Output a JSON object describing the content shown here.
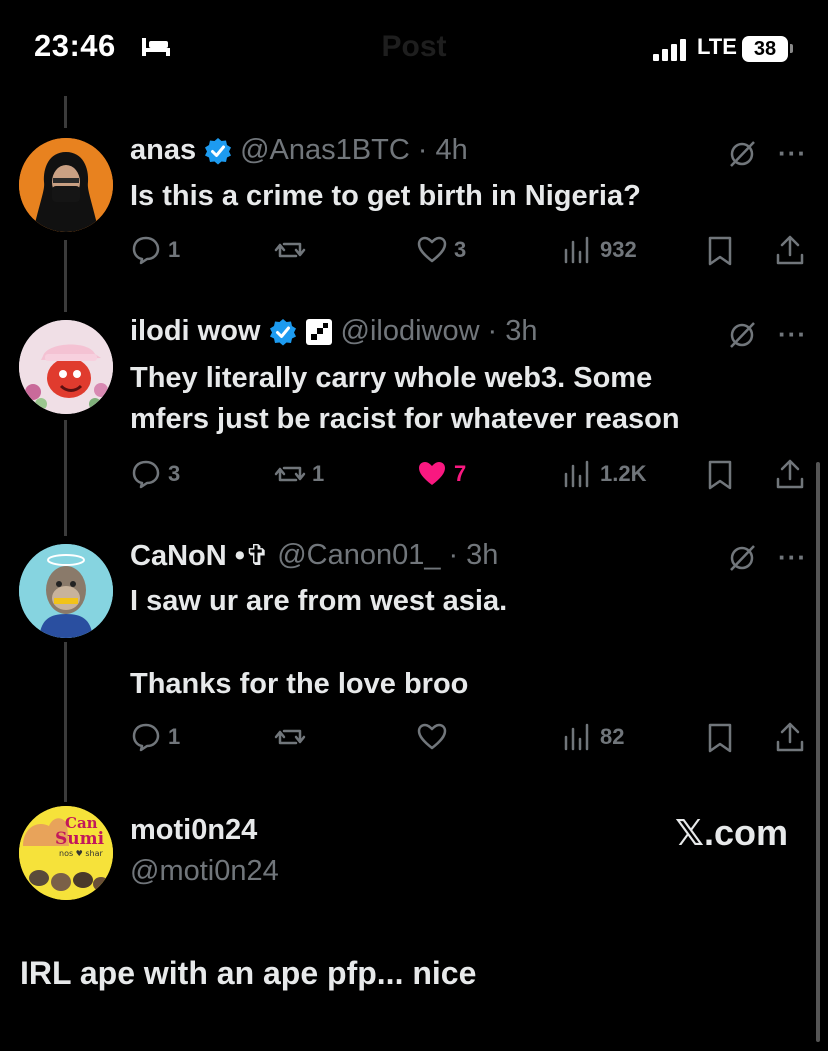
{
  "status_bar": {
    "time": "23:46",
    "network": "LTE",
    "battery": "38"
  },
  "header": {
    "title": "Post"
  },
  "tweets": [
    {
      "name": "anas",
      "handle": "@Anas1BTC",
      "time": "4h",
      "text": "Is this a crime to get birth in Nigeria?",
      "replies": "1",
      "reposts": "",
      "likes": "3",
      "views": "932"
    },
    {
      "name": "ilodi wow",
      "handle": "@ilodiwow",
      "time": "3h",
      "text_line1": "They literally carry whole web3. Some",
      "text_line2": "mfers just be racist for whatever reason",
      "replies": "3",
      "reposts": "1",
      "likes": "7",
      "views": "1.2K"
    },
    {
      "name": "CaNoN •✞",
      "handle": "@Canon01_",
      "time": "3h",
      "text_line1": "I saw ur are from west asia.",
      "text_line2": "Thanks for the love broo",
      "replies": "1",
      "reposts": "",
      "likes": "",
      "views": "82"
    }
  ],
  "quoted": {
    "name": "moti0n24",
    "handle": "@moti0n24",
    "source": "𝕏.com",
    "avatar_text": "Can Sumi"
  },
  "reply_text": "IRL ape with an ape pfp... nice",
  "colors": {
    "background": "#000000",
    "text": "#e7e9ea",
    "muted": "#71767b",
    "verified": "#1d9bf0",
    "like": "#f91880"
  }
}
